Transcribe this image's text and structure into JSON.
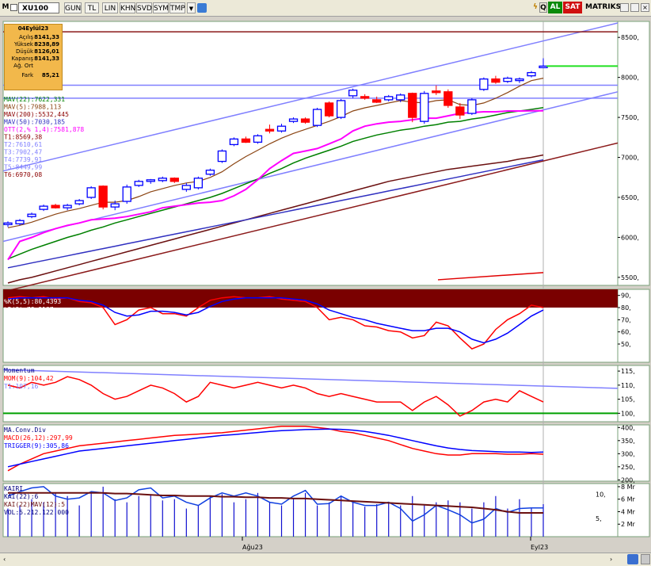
{
  "toolbar": {
    "logo": "M",
    "symbol": "XU100",
    "buttons": [
      "GUN",
      "TL",
      "LIN",
      "KHN",
      "SVD",
      "SYM",
      "TMP"
    ],
    "right_labels": [
      "AL",
      "SAT",
      "MATRIKS"
    ],
    "right_icons": [
      "thunder-icon",
      "q-icon"
    ]
  },
  "info_box": {
    "date": "04Eylül23",
    "rows": [
      {
        "label": "Açılış",
        "value": "8141,33"
      },
      {
        "label": "Yüksek",
        "value": "8238,89"
      },
      {
        "label": "Düşük",
        "value": "8126,01"
      },
      {
        "label": "Kapanış",
        "value": "8141,33"
      },
      {
        "label": "Ağ. Ort",
        "value": ""
      },
      {
        "label": "Fark",
        "value": "85,21"
      }
    ]
  },
  "colors": {
    "mav22": "#008000",
    "mav5": "#8b4513",
    "mav200": "#8b0000",
    "mav50": "#3030c0",
    "ott": "#ff00ff",
    "t_lines": "#8080ff",
    "up": "#0000ff",
    "down": "#ff0000",
    "k": "#ff0000",
    "d": "#0000ff"
  },
  "x_labels": [
    "Ağu23",
    "Eyl23"
  ],
  "chart_data": [
    {
      "type": "candlestick",
      "title": "XU100",
      "ylim": [
        5400,
        8700
      ],
      "yticks": [
        "8500,",
        "8000,",
        "7500,",
        "7000,",
        "6500,",
        "6000,",
        "5500,"
      ],
      "ytick_values": [
        8500,
        8000,
        7500,
        7000,
        6500,
        6000,
        5500
      ],
      "candles": [
        [
          6160,
          6200,
          6130,
          6180
        ],
        [
          6170,
          6230,
          6150,
          6210
        ],
        [
          6260,
          6310,
          6240,
          6290
        ],
        [
          6350,
          6410,
          6330,
          6390
        ],
        [
          6400,
          6420,
          6360,
          6370
        ],
        [
          6370,
          6420,
          6340,
          6400
        ],
        [
          6420,
          6480,
          6400,
          6460
        ],
        [
          6500,
          6640,
          6480,
          6620
        ],
        [
          6640,
          6650,
          6350,
          6380
        ],
        [
          6380,
          6460,
          6340,
          6420
        ],
        [
          6450,
          6660,
          6420,
          6630
        ],
        [
          6650,
          6720,
          6630,
          6700
        ],
        [
          6700,
          6730,
          6670,
          6720
        ],
        [
          6710,
          6760,
          6690,
          6740
        ],
        [
          6740,
          6750,
          6680,
          6700
        ],
        [
          6600,
          6680,
          6570,
          6650
        ],
        [
          6620,
          6760,
          6600,
          6740
        ],
        [
          6790,
          6860,
          6770,
          6840
        ],
        [
          6950,
          7100,
          6930,
          7080
        ],
        [
          7160,
          7250,
          7140,
          7230
        ],
        [
          7230,
          7260,
          7180,
          7190
        ],
        [
          7190,
          7290,
          7170,
          7270
        ],
        [
          7350,
          7410,
          7300,
          7330
        ],
        [
          7330,
          7420,
          7310,
          7390
        ],
        [
          7450,
          7500,
          7430,
          7480
        ],
        [
          7480,
          7500,
          7420,
          7440
        ],
        [
          7400,
          7620,
          7380,
          7600
        ],
        [
          7680,
          7700,
          7500,
          7520
        ],
        [
          7500,
          7730,
          7480,
          7710
        ],
        [
          7770,
          7860,
          7740,
          7840
        ],
        [
          7760,
          7790,
          7720,
          7740
        ],
        [
          7720,
          7760,
          7680,
          7690
        ],
        [
          7720,
          7780,
          7700,
          7760
        ],
        [
          7720,
          7800,
          7690,
          7780
        ],
        [
          7800,
          7810,
          7440,
          7500
        ],
        [
          7450,
          7830,
          7420,
          7800
        ],
        [
          7830,
          7900,
          7780,
          7820
        ],
        [
          7820,
          7850,
          7620,
          7650
        ],
        [
          7630,
          7680,
          7480,
          7530
        ],
        [
          7550,
          7740,
          7530,
          7720
        ],
        [
          7850,
          8000,
          7830,
          7980
        ],
        [
          7980,
          8020,
          7920,
          7940
        ],
        [
          7950,
          8010,
          7930,
          7990
        ],
        [
          7960,
          8000,
          7930,
          7980
        ],
        [
          8020,
          8080,
          8000,
          8060
        ],
        [
          8141.33,
          8238.89,
          8126.01,
          8141.33
        ]
      ],
      "indicators": [
        {
          "name": "MAV(22)",
          "value": ":7622,331"
        },
        {
          "name": "MAV(5)",
          "value": ":7988,113"
        },
        {
          "name": "MAV(200)",
          "value": ":5532,445"
        },
        {
          "name": "MAV(50)",
          "value": ":7030,185"
        },
        {
          "name": "OTT(2,% 1,4)",
          "value": ":7581,878"
        },
        {
          "name": "T1:",
          "value": "8569,38"
        },
        {
          "name": "T2:",
          "value": "7610,61"
        },
        {
          "name": "T3:",
          "value": "7902,47"
        },
        {
          "name": "T4:",
          "value": "7739,91"
        },
        {
          "name": "T5:",
          "value": "8449,99"
        },
        {
          "name": "T6:",
          "value": "6970,08"
        }
      ],
      "mav5": [
        6120,
        6150,
        6190,
        6240,
        6290,
        6330,
        6360,
        6400,
        6440,
        6440,
        6460,
        6510,
        6570,
        6610,
        6650,
        6680,
        6700,
        6750,
        6820,
        6920,
        7010,
        7090,
        7170,
        7240,
        7300,
        7350,
        7400,
        7450,
        7510,
        7580,
        7620,
        7650,
        7680,
        7710,
        7690,
        7680,
        7710,
        7720,
        7660,
        7650,
        7680,
        7740,
        7810,
        7890,
        7960,
        7990
      ],
      "mav22": [
        5730,
        5790,
        5850,
        5900,
        5950,
        6000,
        6040,
        6090,
        6130,
        6180,
        6220,
        6260,
        6300,
        6340,
        6380,
        6420,
        6460,
        6500,
        6550,
        6610,
        6670,
        6730,
        6800,
        6860,
        6930,
        6990,
        7040,
        7090,
        7140,
        7200,
        7240,
        7280,
        7310,
        7340,
        7360,
        7390,
        7410,
        7440,
        7450,
        7480,
        7500,
        7530,
        7560,
        7580,
        7600,
        7622
      ],
      "ott": [
        5720,
        5950,
        6000,
        6060,
        6110,
        6150,
        6180,
        6220,
        6230,
        6240,
        6260,
        6290,
        6320,
        6370,
        6390,
        6410,
        6430,
        6440,
        6460,
        6520,
        6600,
        6720,
        6860,
        6960,
        7050,
        7080,
        7110,
        7170,
        7230,
        7330,
        7390,
        7420,
        7440,
        7450,
        7470,
        7490,
        7490,
        7520,
        7550,
        7560,
        7570,
        7570,
        7580,
        7580,
        7582,
        7582
      ],
      "mav200": [
        5430,
        5470,
        5500,
        5540,
        5580,
        5620,
        5660,
        5700,
        5740,
        5780,
        5820,
        5860,
        5900,
        5940,
        5980,
        6020,
        6060,
        6100,
        6140,
        6180,
        6220,
        6260,
        6300,
        6340,
        6380,
        6420,
        6460,
        6500,
        6540,
        6580,
        6620,
        6660,
        6700,
        6730,
        6760,
        6790,
        6820,
        6850,
        6870,
        6890,
        6910,
        6930,
        6950,
        6980,
        7000,
        7030
      ],
      "t_hlines": [
        8569.38,
        7902.47,
        7739.91
      ],
      "green_segment": 8141.33
    },
    {
      "type": "line",
      "title": "Stochastic",
      "ylim": [
        35,
        95
      ],
      "yticks": [
        "90,",
        "80,",
        "70,",
        "60,",
        "50,"
      ],
      "ytick_values": [
        90,
        80,
        70,
        60,
        50
      ],
      "series": [
        {
          "name": "%K(5,5)",
          "value": ":80,4393",
          "values": [
            88,
            89,
            88,
            89,
            87,
            88,
            85,
            84,
            80,
            66,
            70,
            78,
            80,
            75,
            75,
            73,
            80,
            86,
            88,
            89,
            88,
            88,
            89,
            87,
            86,
            85,
            80,
            70,
            72,
            70,
            65,
            64,
            61,
            60,
            55,
            57,
            68,
            65,
            55,
            46,
            50,
            62,
            70,
            75,
            82,
            80
          ]
        },
        {
          "name": "%D(3)",
          "value": ":78,2137",
          "values": [
            87,
            88,
            88,
            88,
            88,
            88,
            86,
            85,
            82,
            76,
            73,
            74,
            77,
            77,
            76,
            74,
            76,
            81,
            85,
            87,
            88,
            88,
            88,
            88,
            87,
            86,
            83,
            78,
            75,
            72,
            70,
            67,
            65,
            63,
            61,
            61,
            63,
            63,
            60,
            54,
            51,
            54,
            59,
            66,
            73,
            78
          ]
        }
      ]
    },
    {
      "type": "line",
      "title": "Momentum",
      "ylim": [
        97,
        117
      ],
      "yticks": [
        "115,",
        "110,",
        "105,",
        "100,"
      ],
      "ytick_values": [
        115,
        110,
        105,
        100
      ],
      "series": [
        {
          "name": "MOM(9)",
          "value": ":104,42",
          "values": [
            110,
            109,
            111,
            110,
            111,
            113,
            112,
            110,
            107,
            105,
            106,
            108,
            110,
            109,
            107,
            104,
            106,
            111,
            110,
            109,
            110,
            111,
            110,
            109,
            110,
            109,
            107,
            106,
            107,
            106,
            105,
            104,
            104,
            104,
            101,
            104,
            106,
            103,
            99,
            101,
            104,
            105,
            104,
            108,
            106,
            104
          ]
        },
        {
          "name": "T1:",
          "value": "107,16",
          "values": [
            115.5,
            114.5
          ]
        },
        {
          "name": "",
          "values": [
            100,
            100
          ]
        }
      ]
    },
    {
      "type": "line",
      "title": "MA.Conv.Div",
      "ylim": [
        195,
        410
      ],
      "yticks": [
        "400,",
        "350,",
        "300,",
        "250,",
        "200,"
      ],
      "ytick_values": [
        400,
        350,
        300,
        250,
        200
      ],
      "series": [
        {
          "name": "MACD(26,12)",
          "value": ":297,99",
          "values": [
            235,
            260,
            280,
            300,
            310,
            320,
            330,
            335,
            340,
            345,
            350,
            355,
            360,
            365,
            370,
            372,
            375,
            378,
            380,
            385,
            390,
            395,
            400,
            405,
            405,
            405,
            400,
            395,
            385,
            380,
            370,
            360,
            350,
            335,
            320,
            310,
            300,
            295,
            295,
            300,
            300,
            300,
            298,
            298,
            300,
            298
          ]
        },
        {
          "name": "TRIGGER(9)",
          "value": ":305,86",
          "values": [
            250,
            260,
            270,
            280,
            290,
            300,
            310,
            315,
            320,
            325,
            330,
            335,
            340,
            345,
            350,
            355,
            360,
            365,
            370,
            373,
            377,
            381,
            385,
            388,
            390,
            392,
            393,
            394,
            393,
            390,
            385,
            378,
            370,
            360,
            350,
            340,
            330,
            322,
            316,
            312,
            310,
            308,
            306,
            306,
            305,
            306
          ]
        }
      ]
    },
    {
      "type": "bar",
      "title": "KAIRI",
      "ylim": [
        0,
        8.5
      ],
      "yticks": [
        "8 Mr",
        "6 Mr",
        "4 Mr",
        "2 Mr"
      ],
      "ytick_values": [
        8,
        6,
        4,
        2
      ],
      "left_yticks": [
        "10,",
        "5,"
      ],
      "series": [
        {
          "name": "KAI(22)",
          "value": ":6",
          "values": [
            6.5,
            7.2,
            7.8,
            8,
            6.5,
            6,
            6.2,
            7.2,
            7,
            5.8,
            6.2,
            7.5,
            7.8,
            6.2,
            6.5,
            5.5,
            5,
            6.2,
            7,
            6.5,
            7,
            6.5,
            5.5,
            5.2,
            6.5,
            7.4,
            5.2,
            5.3,
            6.5,
            5.5,
            5,
            5,
            5.5,
            4.5,
            2.5,
            3.5,
            5,
            4.3,
            3.5,
            2.2,
            2.8,
            4.5,
            3.9,
            4.5,
            4.6,
            4.6
          ]
        },
        {
          "name": "KAI(22)MAV(12)",
          "value": ":5",
          "values": [
            7,
            7,
            7,
            7,
            7,
            7,
            7,
            7,
            7,
            6.9,
            6.9,
            6.8,
            6.7,
            6.6,
            6.6,
            6.5,
            6.5,
            6.5,
            6.4,
            6.4,
            6.3,
            6.3,
            6.2,
            6.2,
            6.1,
            6.1,
            6,
            5.9,
            5.8,
            5.7,
            5.6,
            5.5,
            5.4,
            5.3,
            5.2,
            5.1,
            5,
            4.9,
            4.8,
            4.7,
            4.5,
            4.3,
            4,
            3.8,
            3.8,
            3.8
          ]
        },
        {
          "name": "VOL",
          "value": ":5.212.122.000",
          "values": [
            4.5,
            5,
            6,
            5.5,
            7,
            6.5,
            5,
            7,
            8,
            6,
            5.5,
            6.5,
            6.8,
            5.8,
            6,
            4.5,
            5,
            6.5,
            6.8,
            5.5,
            6,
            7,
            5.5,
            5,
            6.2,
            7,
            5,
            5.5,
            6.5,
            5.5,
            4.8,
            5.2,
            5.5,
            5,
            6.5,
            5,
            5.5,
            5.8,
            5.5,
            4.5,
            5.5,
            6.5,
            4.5,
            6,
            4.5,
            5.2
          ]
        }
      ]
    }
  ]
}
